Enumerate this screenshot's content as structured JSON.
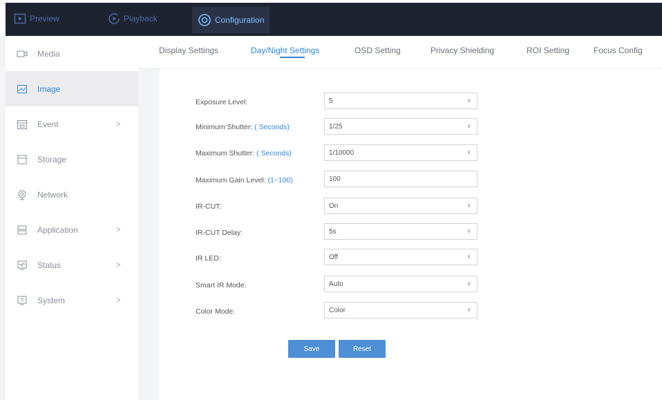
{
  "topnav": {
    "items": [
      {
        "label": "Preview",
        "icon": "preview-icon"
      },
      {
        "label": "Playback",
        "icon": "playback-icon"
      },
      {
        "label": "Configuration",
        "icon": "configuration-icon"
      }
    ],
    "active": "Configuration"
  },
  "sidebar": {
    "items": [
      {
        "label": "Media",
        "icon": "media-icon",
        "has_submenu": false
      },
      {
        "label": "Image",
        "icon": "image-icon",
        "has_submenu": false
      },
      {
        "label": "Event",
        "icon": "event-icon",
        "has_submenu": true
      },
      {
        "label": "Storage",
        "icon": "storage-icon",
        "has_submenu": false
      },
      {
        "label": "Network",
        "icon": "network-icon",
        "has_submenu": false
      },
      {
        "label": "Application",
        "icon": "application-icon",
        "has_submenu": true
      },
      {
        "label": "Status",
        "icon": "status-icon",
        "has_submenu": true
      },
      {
        "label": "System",
        "icon": "system-icon",
        "has_submenu": true
      }
    ],
    "active": "Image",
    "chevron": ">"
  },
  "tabs": {
    "items": [
      {
        "label": "Display Settings"
      },
      {
        "label": "Day/Night Settings"
      },
      {
        "label": "OSD Setting"
      },
      {
        "label": "Privacy Shielding"
      },
      {
        "label": "ROI Setting"
      },
      {
        "label": "Focus Config"
      }
    ],
    "active": "Day/Night Settings"
  },
  "form": {
    "fields": [
      {
        "label": "Exposure Level:",
        "unit": "",
        "value": "5",
        "type": "select"
      },
      {
        "label": "Minimum Shutter:",
        "unit": "( Seconds)",
        "value": "1/25",
        "type": "select"
      },
      {
        "label": "Maximum Shutter:",
        "unit": "( Seconds)",
        "value": "1/10000",
        "type": "select"
      },
      {
        "label": "Maximum Gain Level:",
        "unit": "(1~100)",
        "value": "100",
        "type": "input"
      },
      {
        "label": "IR-CUT:",
        "unit": "",
        "value": "On",
        "type": "select"
      },
      {
        "label": "IR-CUT Delay:",
        "unit": "",
        "value": "5s",
        "type": "select"
      },
      {
        "label": "IR LED:",
        "unit": "",
        "value": "Off",
        "type": "select"
      },
      {
        "label": "Smart IR Mode:",
        "unit": "",
        "value": "Auto",
        "type": "select"
      },
      {
        "label": "Color Mode:",
        "unit": "",
        "value": "Color",
        "type": "select"
      }
    ],
    "dropdown_glyph": "∨",
    "save_label": "Save",
    "reset_label": "Reset"
  },
  "colors": {
    "accent": "#2f86d6",
    "nav_bg": "#1e2330",
    "button": "#4d8fd4"
  }
}
